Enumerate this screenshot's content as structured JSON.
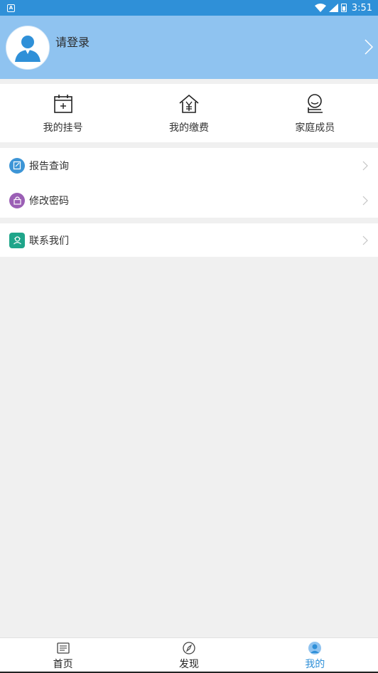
{
  "status_bar": {
    "time": "3:51",
    "icons": [
      "notification-a-icon",
      "wifi-icon",
      "signal-icon",
      "battery-icon"
    ]
  },
  "profile": {
    "login_text": "请登录",
    "avatar_icon": "user-avatar-icon",
    "chevron_icon": "chevron-right-icon"
  },
  "quick_actions": [
    {
      "label": "我的挂号",
      "icon": "calendar-plus-icon"
    },
    {
      "label": "我的缴费",
      "icon": "house-yen-icon"
    },
    {
      "label": "家庭成员",
      "icon": "family-member-icon"
    }
  ],
  "menu": {
    "group1": [
      {
        "label": "报告查询",
        "icon": "report-edit-icon",
        "color": "#3d95d6"
      },
      {
        "label": "修改密码",
        "icon": "lock-icon",
        "color": "#9b5fb5"
      }
    ],
    "group2": [
      {
        "label": "联系我们",
        "icon": "contact-headset-icon",
        "color": "#1fa58a"
      }
    ]
  },
  "bottom_nav": [
    {
      "label": "首页",
      "icon": "home-document-icon",
      "active": false
    },
    {
      "label": "发现",
      "icon": "compass-icon",
      "active": false
    },
    {
      "label": "我的",
      "icon": "profile-icon",
      "active": true
    }
  ],
  "colors": {
    "status_bar": "#2f90d8",
    "header": "#8fc3f0",
    "accent": "#2f90d8",
    "background": "#f0f0f0"
  }
}
